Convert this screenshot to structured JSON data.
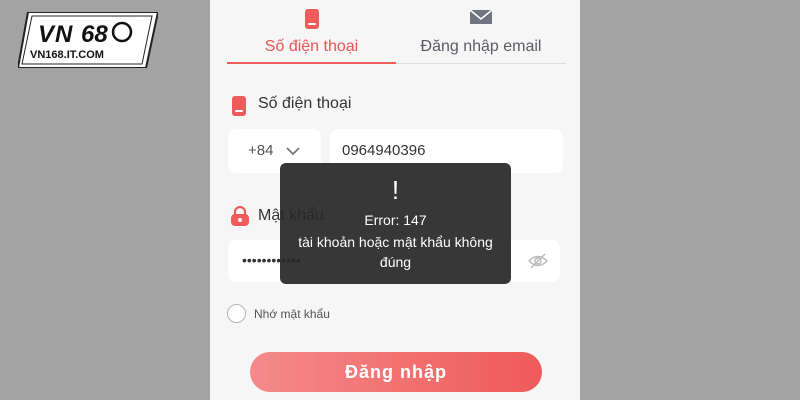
{
  "logo": {
    "text": "VN68",
    "url": "VN168.IT.COM"
  },
  "tabs": [
    {
      "label": "Số điện thoại",
      "icon": "phone-icon"
    },
    {
      "label": "Đăng nhập email",
      "icon": "envelope-icon"
    }
  ],
  "phone_field": {
    "label": "Số điện thoại",
    "country_code": "+84",
    "value": "0964940396"
  },
  "password_field": {
    "label": "Mật khẩu",
    "value": "••••••••••••"
  },
  "remember": {
    "label": "Nhớ mật khẩu"
  },
  "login_button": {
    "label": "Đăng nhập"
  },
  "error": {
    "symbol": "!",
    "title": "Error: 147",
    "message": "tài khoản hoặc mật khẩu không đúng"
  },
  "colors": {
    "accent": "#ef5a5a",
    "background": "#a3a3a3",
    "panel": "#f6f6f6"
  }
}
